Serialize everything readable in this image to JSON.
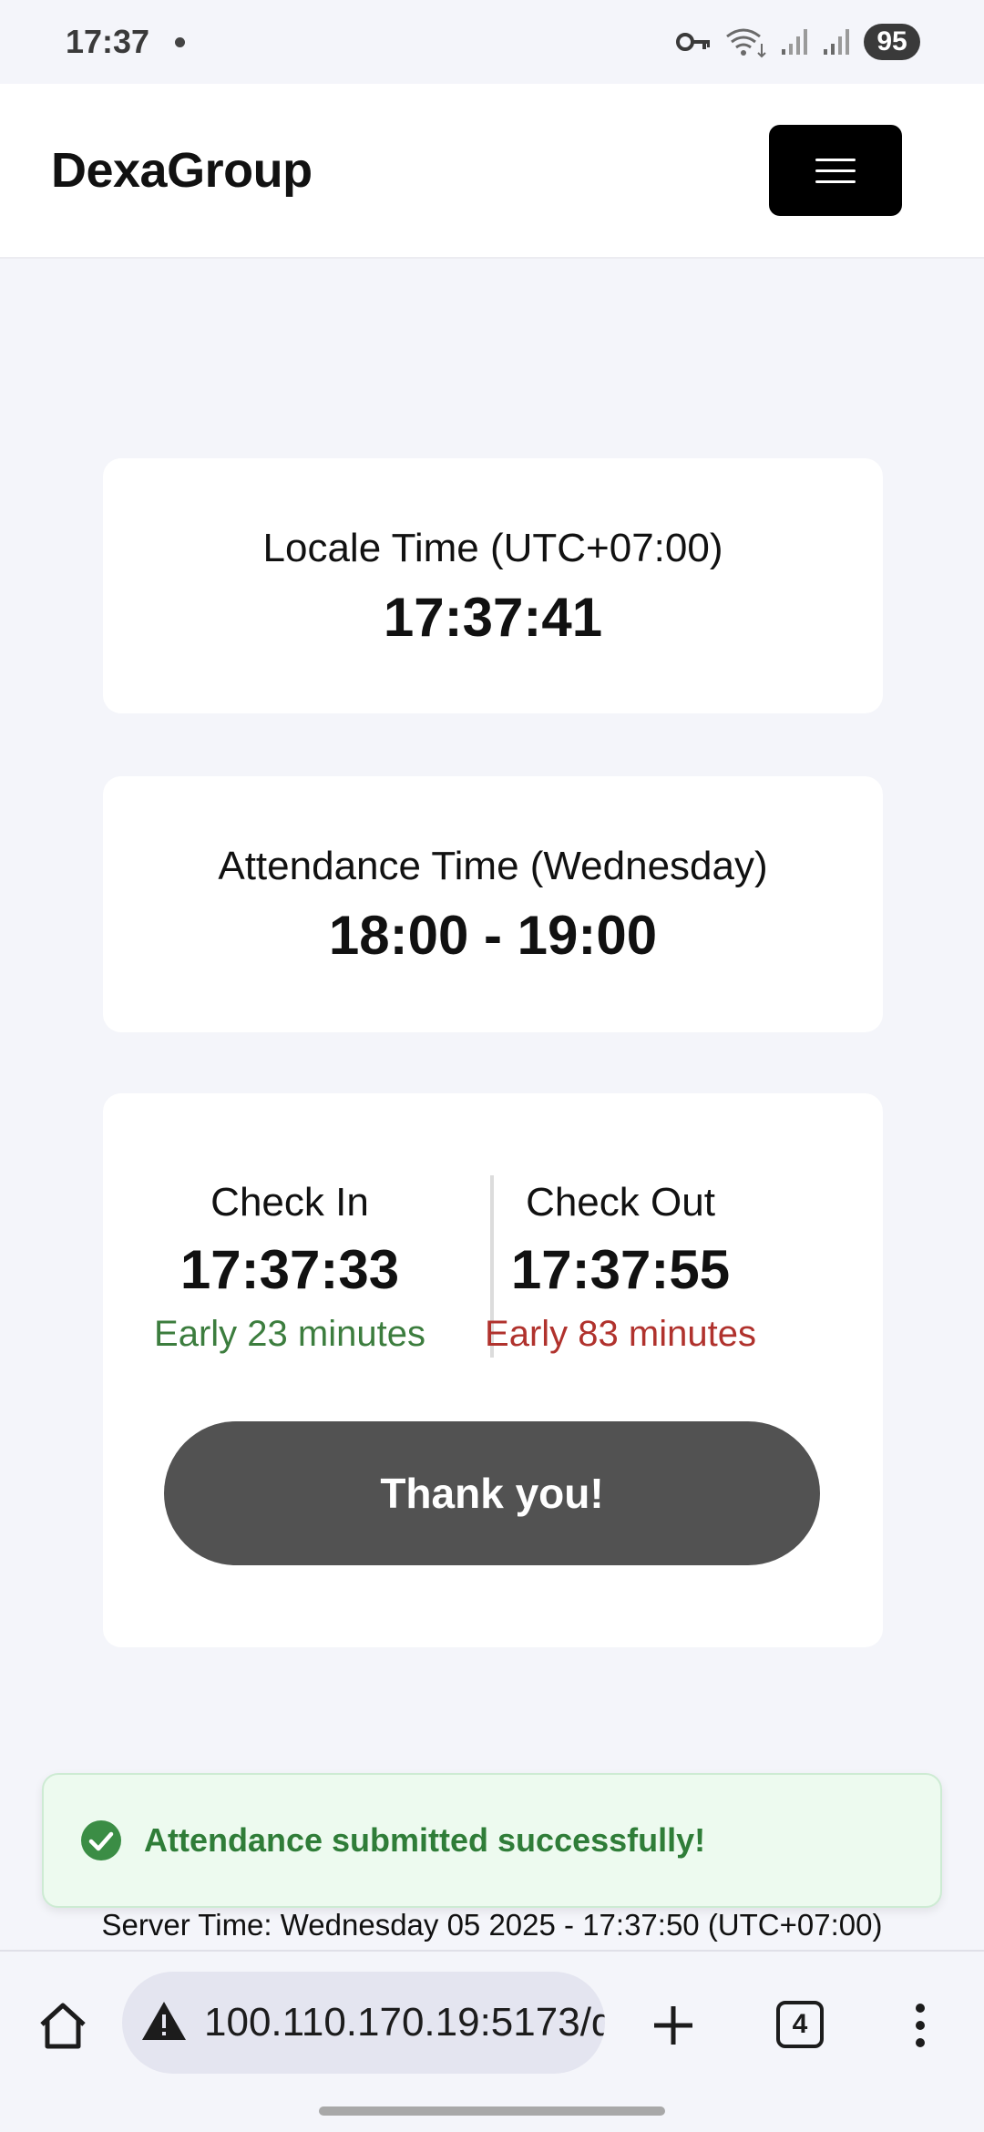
{
  "status_bar": {
    "time": "17:37",
    "battery": "95",
    "icons": [
      "notification-dot-icon",
      "vpn-key-icon",
      "wifi-icon",
      "signal-icon",
      "signal-icon",
      "battery-icon"
    ]
  },
  "header": {
    "brand": "DexaGroup",
    "menu_icon": "hamburger-menu-icon"
  },
  "locale_card": {
    "label": "Locale Time (UTC+07:00)",
    "time": "17:37:41"
  },
  "attendance_card": {
    "label": "Attendance Time (Wednesday)",
    "time_range": "18:00 - 19:00"
  },
  "check_card": {
    "check_in": {
      "label": "Check In",
      "time": "17:37:33",
      "note": "Early 23 minutes",
      "note_color": "#3c7d3e"
    },
    "check_out": {
      "label": "Check Out",
      "time": "17:37:55",
      "note": "Early 83 minutes",
      "note_color": "#b0322d"
    },
    "button_label": "Thank you!"
  },
  "toast": {
    "message": "Attendance submitted successfully!",
    "icon": "check-circle-icon",
    "color": "#2f7d38"
  },
  "server_time": "Server Time: Wednesday 05 2025 - 17:37:50 (UTC+07:00)",
  "browser": {
    "url": "100.110.170.19:5173/d",
    "tab_count": "4",
    "icons": [
      "home-icon",
      "warning-icon",
      "plus-icon",
      "tabs-icon",
      "more-vert-icon"
    ]
  }
}
